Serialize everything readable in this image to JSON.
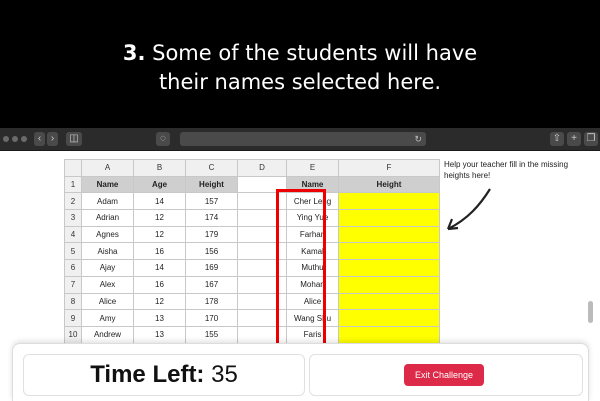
{
  "banner": {
    "number": "3.",
    "line1": "Some of the students will have",
    "line2": "their names selected here."
  },
  "help_text": "Help your teacher fill in the missing heights here!",
  "columns": [
    "A",
    "B",
    "C",
    "D",
    "E",
    "F"
  ],
  "headers": {
    "name": "Name",
    "age": "Age",
    "height": "Height",
    "e_name": "Name",
    "f_height": "Height"
  },
  "rows": [
    {
      "n": "2",
      "name": "Adam",
      "age": "14",
      "height": "157",
      "sel": "Cher Leng"
    },
    {
      "n": "3",
      "name": "Adrian",
      "age": "12",
      "height": "174",
      "sel": "Ying Yue"
    },
    {
      "n": "4",
      "name": "Agnes",
      "age": "12",
      "height": "179",
      "sel": "Farhan"
    },
    {
      "n": "5",
      "name": "Aisha",
      "age": "16",
      "height": "156",
      "sel": "Kamal"
    },
    {
      "n": "6",
      "name": "Ajay",
      "age": "14",
      "height": "169",
      "sel": "Muthu"
    },
    {
      "n": "7",
      "name": "Alex",
      "age": "16",
      "height": "167",
      "sel": "Mohan"
    },
    {
      "n": "8",
      "name": "Alice",
      "age": "12",
      "height": "178",
      "sel": "Alice"
    },
    {
      "n": "9",
      "name": "Amy",
      "age": "13",
      "height": "170",
      "sel": "Wang Shu"
    },
    {
      "n": "10",
      "name": "Andrew",
      "age": "13",
      "height": "155",
      "sel": "Faris"
    }
  ],
  "timer": {
    "label": "Time Left:",
    "value": "35"
  },
  "exit_label": "Exit Challenge",
  "colors": {
    "highlight": "#ffff00",
    "selection_box": "#ee0000",
    "exit_button": "#dc2a48"
  }
}
